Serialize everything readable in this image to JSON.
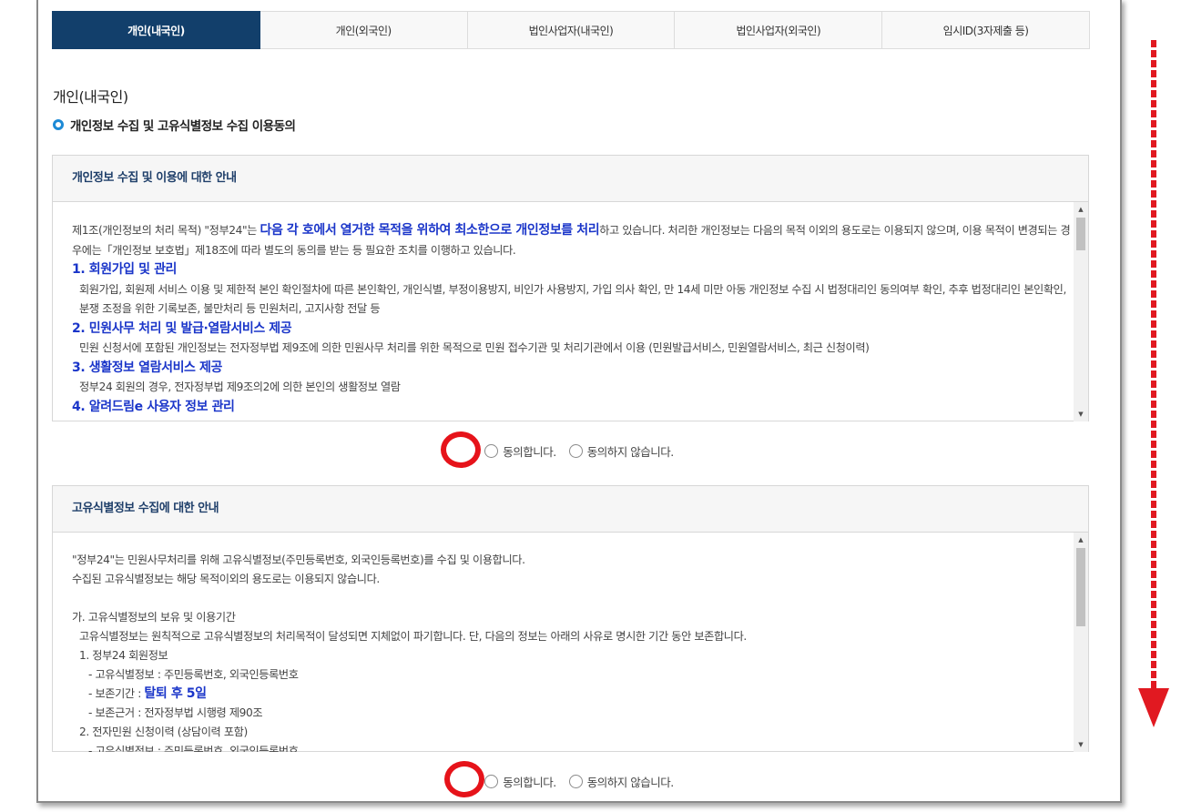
{
  "tabs": [
    {
      "label": "개인(내국인)",
      "active": true
    },
    {
      "label": "개인(외국인)",
      "active": false
    },
    {
      "label": "법인사업자(내국인)",
      "active": false
    },
    {
      "label": "법인사업자(외국인)",
      "active": false
    },
    {
      "label": "임시ID(3자제출 등)",
      "active": false
    }
  ],
  "section_title": "개인(내국인)",
  "sub_title": "개인정보 수집 및 고유식별정보 수집 이용동의",
  "box1": {
    "heading": "개인정보 수집 및 이용에 대한 안내",
    "intro_pre": "제1조(개인정보의 처리 목적) \"정부24\"는 ",
    "intro_hl": "다음 각 호에서 열거한 목적을 위하여 최소한으로 개인정보를 처리",
    "intro_post": "하고 있습니다. 처리한 개인정보는 다음의 목적 이외의 용도로는 이용되지 않으며, 이용 목적이 변경되는 경우에는「개인정보 보호법」제18조에 따라 별도의 동의를 받는 등 필요한 조치를 이행하고 있습니다.",
    "items": [
      {
        "title": "1. 회원가입 및 관리",
        "desc": "회원가입, 회원제 서비스 이용 및 제한적 본인 확인절차에 따른 본인확인, 개인식별, 부정이용방지, 비인가 사용방지, 가입 의사 확인, 만 14세 미만 아동 개인정보 수집 시 법정대리인 동의여부 확인, 추후 법정대리인 본인확인, 분쟁 조정을 위한 기록보존, 불만처리 등 민원처리, 고지사항 전달 등"
      },
      {
        "title": "2. 민원사무 처리 및 발급·열람서비스 제공",
        "desc": "민원 신청서에 포함된 개인정보는 전자정부법 제9조에 의한 민원사무 처리를 위한 목적으로 민원 접수기관 및 처리기관에서 이용 (민원발급서비스, 민원열람서비스, 최근 신청이력)"
      },
      {
        "title": "3. 생활정보 열람서비스 제공",
        "desc": "정부24 회원의 경우, 전자정부법 제9조의2에 의한 본인의 생활정보 열람"
      },
      {
        "title": "4. 알려드림e 사용자 정보 관리",
        "desc": ""
      }
    ]
  },
  "box2": {
    "heading": "고유식별정보 수집에 대한 안내",
    "lines": [
      "\"정부24\"는 민원사무처리를 위해 고유식별정보(주민등록번호, 외국인등록번호)를 수집 및 이용합니다.",
      "수집된 고유식별정보는 해당 목적이외의 용도로는 이용되지 않습니다.",
      "",
      "가. 고유식별정보의 보유 및 이용기간",
      "고유식별정보는 원칙적으로 고유식별정보의 처리목적이 달성되면 지체없이 파기합니다. 단, 다음의 정보는 아래의 사유로 명시한 기간 동안 보존합니다.",
      "1. 정부24 회원정보",
      "- 고유식별정보 : 주민등록번호, 외국인등록번호"
    ],
    "period_label": "- 보존기간 : ",
    "period_value": "탈퇴 후 5일",
    "lines_after": [
      "- 보존근거 : 전자정부법 시행령 제90조",
      "2. 전자민원 신청이력 (상담이력 포함)",
      "- 고유식별정보 : 주민등록번호, 외국인등록번호"
    ]
  },
  "consent": {
    "agree_label": "동의합니다.",
    "disagree_label": "동의하지 않습니다."
  },
  "colors": {
    "active_tab": "#123f6b",
    "highlight_blue": "#1a35c9",
    "annotation_red": "#e6131a"
  }
}
